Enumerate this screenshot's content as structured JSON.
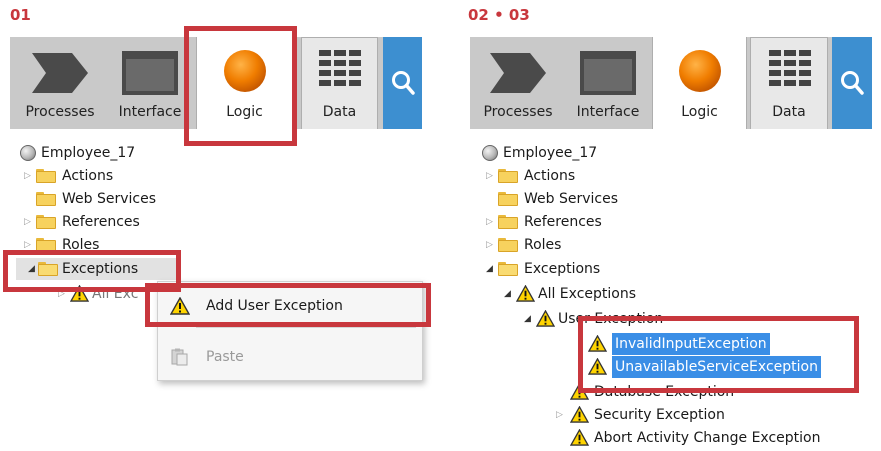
{
  "steps": {
    "left": "01",
    "right": "02 • 03"
  },
  "toolbar": {
    "tabs": [
      "Processes",
      "Interface",
      "Logic",
      "Data"
    ],
    "icons": [
      "process-chevron-icon",
      "interface-window-icon",
      "logic-orange-circle-icon",
      "data-grid-icon",
      "search-icon"
    ]
  },
  "left_tree": {
    "root": "Employee_17",
    "items": [
      "Actions",
      "Web Services",
      "References",
      "Roles",
      "Exceptions"
    ],
    "partial_item": "All Exc"
  },
  "context_menu": {
    "items": [
      {
        "label": "Add User Exception",
        "icon": "warning-icon"
      },
      {
        "label": "Paste",
        "icon": "clipboard-icon",
        "disabled": true
      }
    ]
  },
  "right_tree": {
    "root": "Employee_17",
    "items": [
      "Actions",
      "Web Services",
      "References",
      "Roles",
      "Exceptions"
    ],
    "all_exceptions": "All Exceptions",
    "user_exception": "User Exception",
    "new_exceptions": [
      "InvalidInputException",
      "UnavailableServiceException"
    ],
    "other_exceptions": [
      "Database Exception",
      "Security Exception",
      "Abort Activity Change Exception"
    ]
  },
  "colors": {
    "accent_red": "#c8373d",
    "selection_blue": "#3a8ee6",
    "search_blue": "#3d8fd0",
    "logic_orange": "#f07d00"
  }
}
